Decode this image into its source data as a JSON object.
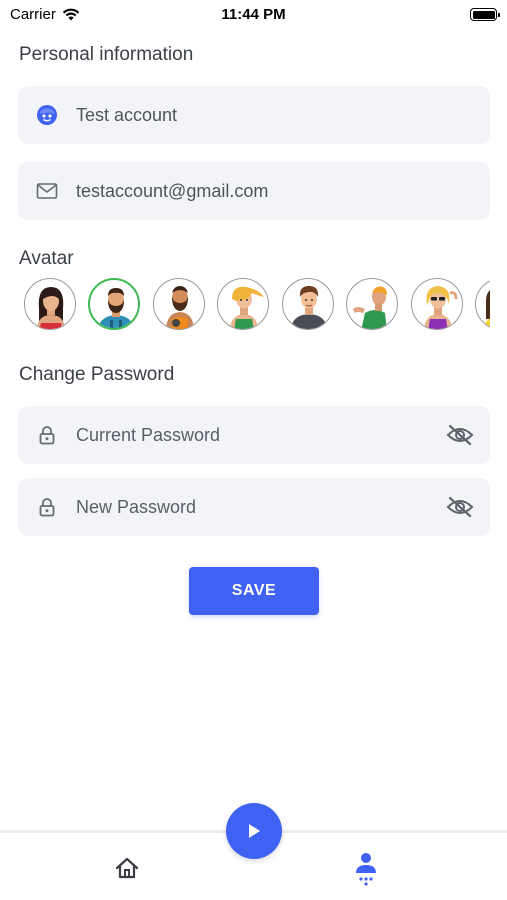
{
  "status_bar": {
    "carrier": "Carrier",
    "time": "11:44 PM"
  },
  "personal": {
    "title": "Personal information",
    "name_value": "Test account",
    "email_value": "testaccount@gmail.com"
  },
  "avatar_section": {
    "title": "Avatar",
    "items": [
      {
        "name": "avatar-woman-dark-hair",
        "selected": false
      },
      {
        "name": "avatar-man-beard",
        "selected": true
      },
      {
        "name": "avatar-man-bald-beard",
        "selected": false
      },
      {
        "name": "avatar-woman-blonde",
        "selected": false
      },
      {
        "name": "avatar-man-brown-hair",
        "selected": false
      },
      {
        "name": "avatar-runner",
        "selected": false
      },
      {
        "name": "avatar-woman-sunglasses",
        "selected": false
      },
      {
        "name": "avatar-partial",
        "selected": false
      }
    ]
  },
  "password": {
    "title": "Change Password",
    "current_placeholder": "Current Password",
    "new_placeholder": "New Password"
  },
  "save_label": "SAVE",
  "colors": {
    "accent": "#3f62f2",
    "selected_avatar_border": "#3fb953",
    "field_bg": "#f3f4f8"
  },
  "icons": {
    "name_field": "user-face-icon",
    "email_field": "mail-icon",
    "password_field": "lock-icon",
    "visibility": "eye-off-icon",
    "tab_home": "home-icon",
    "tab_profile": "profile-icon",
    "fab": "play-icon"
  }
}
